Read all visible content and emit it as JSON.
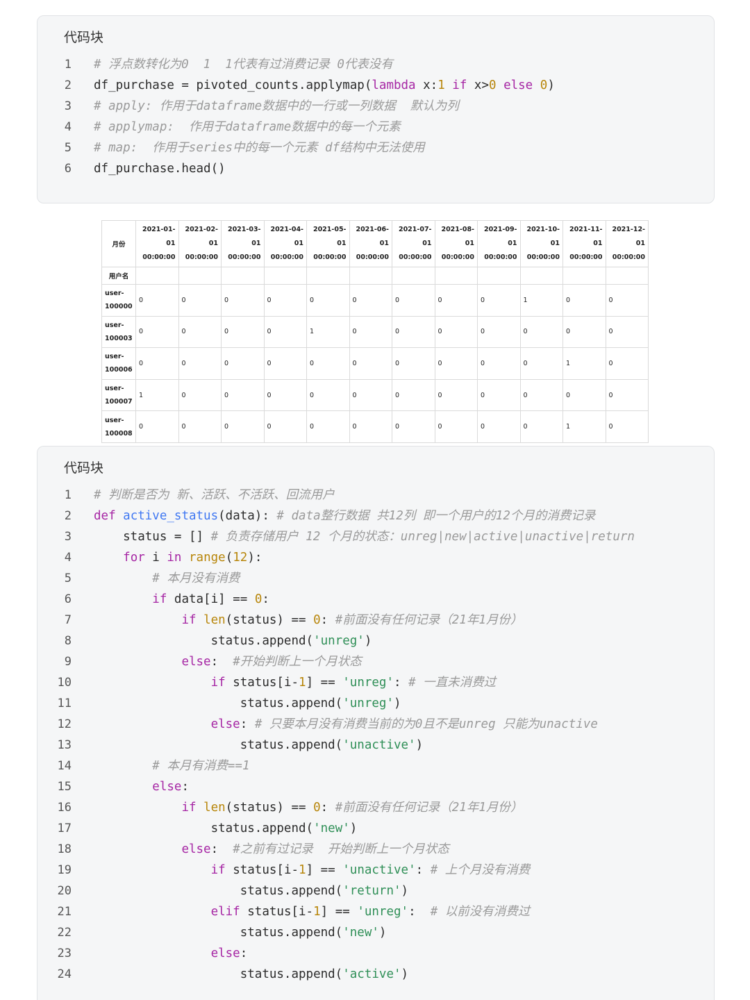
{
  "block1": {
    "title": "代码块",
    "lines": [
      {
        "n": "1",
        "tokens": [
          {
            "t": "# 浮点数转化为0  1  1代表有过消费记录 0代表没有",
            "c": "cm"
          }
        ]
      },
      {
        "n": "2",
        "tokens": [
          {
            "t": "df_purchase = pivoted_counts.applymap("
          },
          {
            "t": "lambda",
            "c": "kw"
          },
          {
            "t": " x:"
          },
          {
            "t": "1",
            "c": "num"
          },
          {
            "t": " "
          },
          {
            "t": "if",
            "c": "kw"
          },
          {
            "t": " x>"
          },
          {
            "t": "0",
            "c": "num"
          },
          {
            "t": " "
          },
          {
            "t": "else",
            "c": "kw"
          },
          {
            "t": " "
          },
          {
            "t": "0",
            "c": "num"
          },
          {
            "t": ")"
          }
        ]
      },
      {
        "n": "3",
        "tokens": [
          {
            "t": "# apply: 作用于dataframe数据中的一行或一列数据  默认为列",
            "c": "cm"
          }
        ]
      },
      {
        "n": "4",
        "tokens": [
          {
            "t": "# applymap:  作用于dataframe数据中的每一个元素",
            "c": "cm"
          }
        ]
      },
      {
        "n": "5",
        "tokens": [
          {
            "t": "# map:  作用于series中的每一个元素 df结构中无法使用",
            "c": "cm"
          }
        ]
      },
      {
        "n": "6",
        "tokens": [
          {
            "t": "df_purchase.head()"
          }
        ]
      }
    ]
  },
  "table": {
    "month_label": "月份",
    "user_label": "用户名",
    "columns": [
      [
        "2021-01-01",
        "00:00:00"
      ],
      [
        "2021-02-01",
        "00:00:00"
      ],
      [
        "2021-03-01",
        "00:00:00"
      ],
      [
        "2021-04-01",
        "00:00:00"
      ],
      [
        "2021-05-01",
        "00:00:00"
      ],
      [
        "2021-06-01",
        "00:00:00"
      ],
      [
        "2021-07-01",
        "00:00:00"
      ],
      [
        "2021-08-01",
        "00:00:00"
      ],
      [
        "2021-09-01",
        "00:00:00"
      ],
      [
        "2021-10-01",
        "00:00:00"
      ],
      [
        "2021-11-01",
        "00:00:00"
      ],
      [
        "2021-12-01",
        "00:00:00"
      ]
    ],
    "rows": [
      {
        "index": [
          "user-",
          "100000"
        ],
        "values": [
          "0",
          "0",
          "0",
          "0",
          "0",
          "0",
          "0",
          "0",
          "0",
          "1",
          "0",
          "0"
        ]
      },
      {
        "index": [
          "user-",
          "100003"
        ],
        "values": [
          "0",
          "0",
          "0",
          "0",
          "1",
          "0",
          "0",
          "0",
          "0",
          "0",
          "0",
          "0"
        ]
      },
      {
        "index": [
          "user-",
          "100006"
        ],
        "values": [
          "0",
          "0",
          "0",
          "0",
          "0",
          "0",
          "0",
          "0",
          "0",
          "0",
          "1",
          "0"
        ]
      },
      {
        "index": [
          "user-",
          "100007"
        ],
        "values": [
          "1",
          "0",
          "0",
          "0",
          "0",
          "0",
          "0",
          "0",
          "0",
          "0",
          "0",
          "0"
        ]
      },
      {
        "index": [
          "user-",
          "100008"
        ],
        "values": [
          "0",
          "0",
          "0",
          "0",
          "0",
          "0",
          "0",
          "0",
          "0",
          "0",
          "1",
          "0"
        ]
      }
    ]
  },
  "block2": {
    "title": "代码块",
    "lines": [
      {
        "n": "1",
        "tokens": [
          {
            "t": "# 判断是否为 新、活跃、不活跃、回流用户",
            "c": "cm"
          }
        ]
      },
      {
        "n": "2",
        "tokens": [
          {
            "t": "def",
            "c": "kw"
          },
          {
            "t": " "
          },
          {
            "t": "active_status",
            "c": "fn"
          },
          {
            "t": "(data): "
          },
          {
            "t": "# data整行数据 共12列 即一个用户的12个月的消费记录",
            "c": "cm"
          }
        ]
      },
      {
        "n": "3",
        "tokens": [
          {
            "t": "    status = [] "
          },
          {
            "t": "# 负责存储用户 12 个月的状态：unreg|new|active|unactive|return",
            "c": "cm"
          }
        ]
      },
      {
        "n": "4",
        "tokens": [
          {
            "t": "    "
          },
          {
            "t": "for",
            "c": "kw"
          },
          {
            "t": " i "
          },
          {
            "t": "in",
            "c": "kw"
          },
          {
            "t": " "
          },
          {
            "t": "range",
            "c": "bi"
          },
          {
            "t": "("
          },
          {
            "t": "12",
            "c": "num"
          },
          {
            "t": "):"
          }
        ]
      },
      {
        "n": "5",
        "tokens": [
          {
            "t": "        "
          },
          {
            "t": "# 本月没有消费",
            "c": "cm"
          }
        ]
      },
      {
        "n": "6",
        "tokens": [
          {
            "t": "        "
          },
          {
            "t": "if",
            "c": "kw"
          },
          {
            "t": " data[i] == "
          },
          {
            "t": "0",
            "c": "num"
          },
          {
            "t": ":"
          }
        ]
      },
      {
        "n": "7",
        "tokens": [
          {
            "t": "            "
          },
          {
            "t": "if",
            "c": "kw"
          },
          {
            "t": " "
          },
          {
            "t": "len",
            "c": "bi"
          },
          {
            "t": "(status) == "
          },
          {
            "t": "0",
            "c": "num"
          },
          {
            "t": ": "
          },
          {
            "t": "#前面没有任何记录（21年1月份）",
            "c": "cm"
          }
        ]
      },
      {
        "n": "8",
        "tokens": [
          {
            "t": "                status.append("
          },
          {
            "t": "'unreg'",
            "c": "str"
          },
          {
            "t": ")"
          }
        ]
      },
      {
        "n": "9",
        "tokens": [
          {
            "t": "            "
          },
          {
            "t": "else",
            "c": "kw"
          },
          {
            "t": ":  "
          },
          {
            "t": "#开始判断上一个月状态",
            "c": "cm"
          }
        ]
      },
      {
        "n": "10",
        "tokens": [
          {
            "t": "                "
          },
          {
            "t": "if",
            "c": "kw"
          },
          {
            "t": " status[i-"
          },
          {
            "t": "1",
            "c": "num"
          },
          {
            "t": "] == "
          },
          {
            "t": "'unreg'",
            "c": "str"
          },
          {
            "t": ": "
          },
          {
            "t": "# 一直未消费过",
            "c": "cm"
          }
        ]
      },
      {
        "n": "11",
        "tokens": [
          {
            "t": "                    status.append("
          },
          {
            "t": "'unreg'",
            "c": "str"
          },
          {
            "t": ")"
          }
        ]
      },
      {
        "n": "12",
        "tokens": [
          {
            "t": "                "
          },
          {
            "t": "else",
            "c": "kw"
          },
          {
            "t": ": "
          },
          {
            "t": "# 只要本月没有消费当前的为0且不是unreg 只能为unactive",
            "c": "cm"
          }
        ]
      },
      {
        "n": "13",
        "tokens": [
          {
            "t": "                    status.append("
          },
          {
            "t": "'unactive'",
            "c": "str"
          },
          {
            "t": ")"
          }
        ]
      },
      {
        "n": "14",
        "tokens": [
          {
            "t": "        "
          },
          {
            "t": "# 本月有消费==1",
            "c": "cm"
          }
        ]
      },
      {
        "n": "15",
        "tokens": [
          {
            "t": "        "
          },
          {
            "t": "else",
            "c": "kw"
          },
          {
            "t": ":"
          }
        ]
      },
      {
        "n": "16",
        "tokens": [
          {
            "t": "            "
          },
          {
            "t": "if",
            "c": "kw"
          },
          {
            "t": " "
          },
          {
            "t": "len",
            "c": "bi"
          },
          {
            "t": "(status) == "
          },
          {
            "t": "0",
            "c": "num"
          },
          {
            "t": ": "
          },
          {
            "t": "#前面没有任何记录（21年1月份）",
            "c": "cm"
          }
        ]
      },
      {
        "n": "17",
        "tokens": [
          {
            "t": "                status.append("
          },
          {
            "t": "'new'",
            "c": "str"
          },
          {
            "t": ")"
          }
        ]
      },
      {
        "n": "18",
        "tokens": [
          {
            "t": "            "
          },
          {
            "t": "else",
            "c": "kw"
          },
          {
            "t": ":  "
          },
          {
            "t": "#之前有过记录  开始判断上一个月状态",
            "c": "cm"
          }
        ]
      },
      {
        "n": "19",
        "tokens": [
          {
            "t": "                "
          },
          {
            "t": "if",
            "c": "kw"
          },
          {
            "t": " status[i-"
          },
          {
            "t": "1",
            "c": "num"
          },
          {
            "t": "] == "
          },
          {
            "t": "'unactive'",
            "c": "str"
          },
          {
            "t": ": "
          },
          {
            "t": "# 上个月没有消费",
            "c": "cm"
          }
        ]
      },
      {
        "n": "20",
        "tokens": [
          {
            "t": "                    status.append("
          },
          {
            "t": "'return'",
            "c": "str"
          },
          {
            "t": ")"
          }
        ]
      },
      {
        "n": "21",
        "tokens": [
          {
            "t": "                "
          },
          {
            "t": "elif",
            "c": "kw"
          },
          {
            "t": " status[i-"
          },
          {
            "t": "1",
            "c": "num"
          },
          {
            "t": "] == "
          },
          {
            "t": "'unreg'",
            "c": "str"
          },
          {
            "t": ":  "
          },
          {
            "t": "# 以前没有消费过",
            "c": "cm"
          }
        ]
      },
      {
        "n": "22",
        "tokens": [
          {
            "t": "                    status.append("
          },
          {
            "t": "'new'",
            "c": "str"
          },
          {
            "t": ")"
          }
        ]
      },
      {
        "n": "23",
        "tokens": [
          {
            "t": "                "
          },
          {
            "t": "else",
            "c": "kw"
          },
          {
            "t": ":"
          }
        ]
      },
      {
        "n": "24",
        "tokens": [
          {
            "t": "                    status.append("
          },
          {
            "t": "'active'",
            "c": "str"
          },
          {
            "t": ")"
          }
        ]
      }
    ]
  }
}
